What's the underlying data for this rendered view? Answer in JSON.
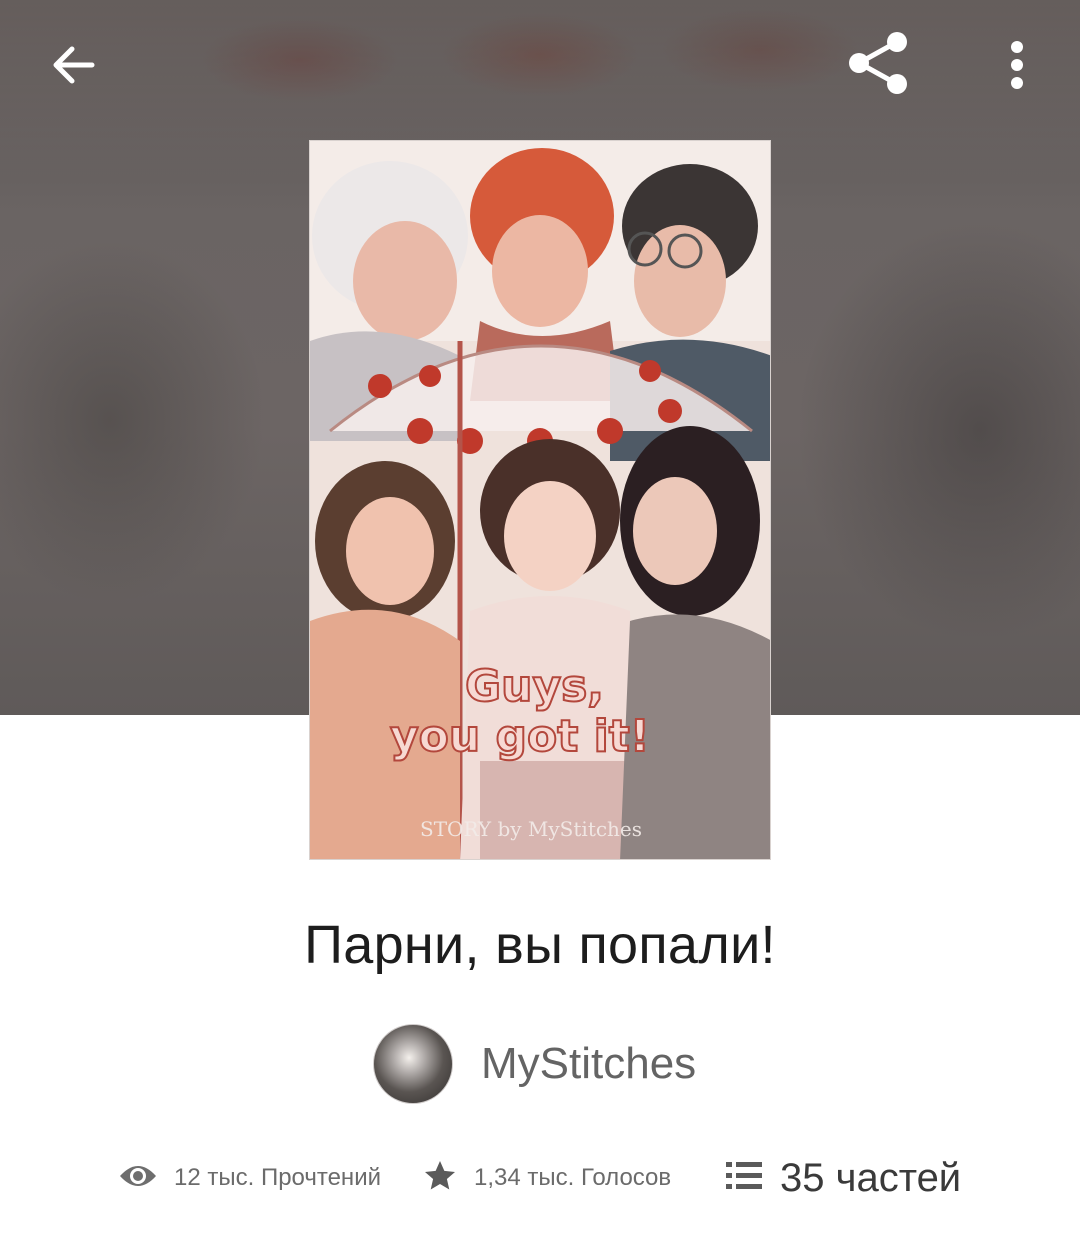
{
  "header": {
    "back_icon": "arrow-back-icon",
    "share_icon": "share-icon",
    "more_icon": "more-vertical-icon"
  },
  "cover": {
    "title_line1": "Guys,",
    "title_line2": "you got it!",
    "credit": "STORY by MyStitches"
  },
  "story": {
    "title": "Парни, вы попали!",
    "author": "MyStitches"
  },
  "stats": {
    "reads": "12 тыс. Прочтений",
    "votes": "1,34 тыс. Голосов",
    "parts": "35 частей"
  },
  "colors": {
    "title_text": "#1d1d1d",
    "author_text": "#646464",
    "stat_text": "#6b6b6b",
    "cover_accent": "#c0392b"
  }
}
